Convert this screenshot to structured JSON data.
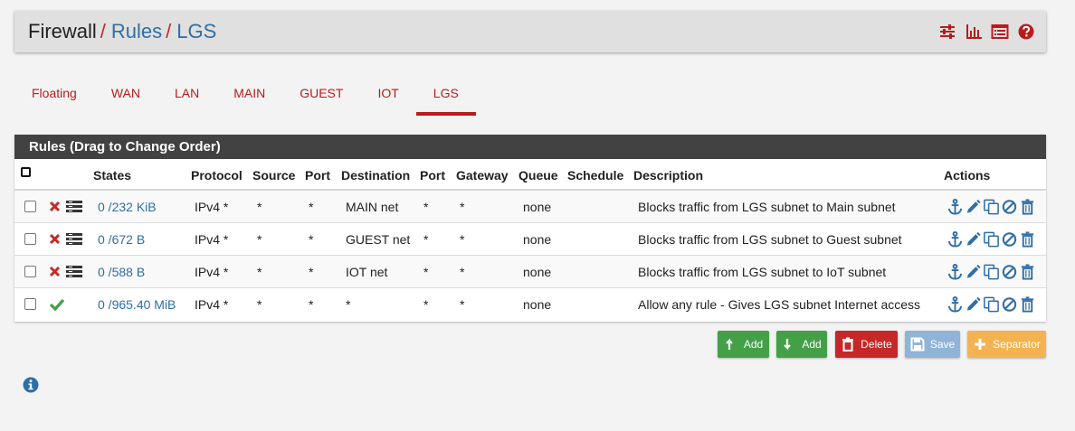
{
  "breadcrumb": {
    "root": "Firewall",
    "sep": "/",
    "level2": "Rules",
    "level3": "LGS"
  },
  "header_icons": [
    "sliders-icon",
    "bar-chart-icon",
    "list-table-icon",
    "help-icon"
  ],
  "tabs": [
    {
      "label": "Floating",
      "active": false
    },
    {
      "label": "WAN",
      "active": false
    },
    {
      "label": "LAN",
      "active": false
    },
    {
      "label": "MAIN",
      "active": false
    },
    {
      "label": "GUEST",
      "active": false
    },
    {
      "label": "IOT",
      "active": false
    },
    {
      "label": "LGS",
      "active": true
    }
  ],
  "panel": {
    "title": "Rules (Drag to Change Order)",
    "columns": {
      "states": "States",
      "protocol": "Protocol",
      "source": "Source",
      "port": "Port",
      "destination": "Destination",
      "port2": "Port",
      "gateway": "Gateway",
      "queue": "Queue",
      "schedule": "Schedule",
      "description": "Description",
      "actions": "Actions"
    },
    "rows": [
      {
        "action": "block",
        "states": "0 /232 KiB",
        "protocol": "IPv4 *",
        "source": "*",
        "port": "*",
        "destination": "MAIN net",
        "dport": "*",
        "gateway": "*",
        "queue": "none",
        "schedule": "",
        "description": "Blocks traffic from LGS subnet to Main subnet"
      },
      {
        "action": "block",
        "states": "0 /672 B",
        "protocol": "IPv4 *",
        "source": "*",
        "port": "*",
        "destination": "GUEST net",
        "dport": "*",
        "gateway": "*",
        "queue": "none",
        "schedule": "",
        "description": "Blocks traffic from LGS subnet to Guest subnet"
      },
      {
        "action": "block",
        "states": "0 /588 B",
        "protocol": "IPv4 *",
        "source": "*",
        "port": "*",
        "destination": "IOT net",
        "dport": "*",
        "gateway": "*",
        "queue": "none",
        "schedule": "",
        "description": "Blocks traffic from LGS subnet to IoT subnet"
      },
      {
        "action": "pass",
        "states": "0 /965.40 MiB",
        "protocol": "IPv4 *",
        "source": "*",
        "port": "*",
        "destination": "*",
        "dport": "*",
        "gateway": "*",
        "queue": "none",
        "schedule": "",
        "description": "Allow any rule - Gives LGS subnet Internet access"
      }
    ]
  },
  "buttons": {
    "add_top": "Add",
    "add_bottom": "Add",
    "delete": "Delete",
    "save": "Save",
    "separator": "Separator"
  },
  "colors": {
    "accent_red": "#b71c1c",
    "link_blue": "#2f6ea5",
    "green": "#43a047",
    "orange": "#f4b350",
    "panel_head": "#424242"
  }
}
